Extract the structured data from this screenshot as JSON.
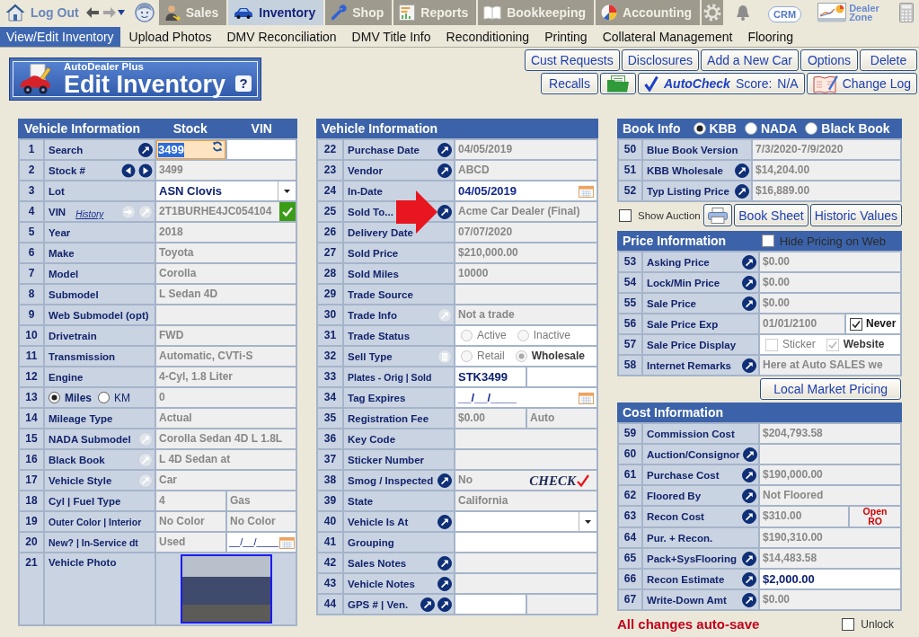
{
  "top_nav": {
    "logout": "Log Out",
    "tabs": [
      {
        "label": "Sales",
        "selected": false
      },
      {
        "label": "Inventory",
        "selected": true
      },
      {
        "label": "Shop",
        "selected": false
      },
      {
        "label": "Reports",
        "selected": false
      },
      {
        "label": "Bookkeeping",
        "selected": false
      },
      {
        "label": "Accounting",
        "selected": false
      }
    ],
    "crm": "CRM",
    "dealer_zone": "Dealer Zone"
  },
  "sub_nav": [
    {
      "label": "View/Edit Inventory",
      "selected": true
    },
    {
      "label": "Upload Photos",
      "selected": false
    },
    {
      "label": "DMV Reconciliation",
      "selected": false
    },
    {
      "label": "DMV Title Info",
      "selected": false
    },
    {
      "label": "Reconditioning",
      "selected": false
    },
    {
      "label": "Printing",
      "selected": false
    },
    {
      "label": "Collateral Management",
      "selected": false
    },
    {
      "label": "Flooring",
      "selected": false
    }
  ],
  "header": {
    "brand": "AutoDealer Plus",
    "title": "Edit Inventory",
    "help": "?"
  },
  "action_buttons": [
    [
      {
        "kind": "text",
        "label": "Cust Requests"
      },
      {
        "kind": "text",
        "label": "Disclosures"
      },
      {
        "kind": "text",
        "label": "Add a New Car"
      },
      {
        "kind": "text",
        "label": "Options"
      },
      {
        "kind": "text",
        "label": "Delete"
      }
    ],
    [
      {
        "kind": "text",
        "label": "Recalls"
      },
      {
        "kind": "folder"
      },
      {
        "kind": "autocheck",
        "label": "AutoCheck",
        "score_label": "Score:",
        "score": "N/A"
      },
      {
        "kind": "changelog",
        "label": "Change Log"
      }
    ]
  ],
  "vehicle_info": {
    "headers": [
      "Vehicle Information",
      "Stock",
      "VIN"
    ],
    "rows": [
      {
        "num": "1",
        "label": "Search",
        "actions": [
          {
            "kind": "jump",
            "disabled": false
          }
        ],
        "cells": [
          {
            "kind": "search",
            "value": "3499"
          },
          {
            "kind": "input"
          }
        ]
      },
      {
        "num": "2",
        "label": "Stock #",
        "actions": [
          {
            "kind": "prev",
            "disabled": false
          },
          {
            "kind": "next",
            "disabled": false
          }
        ],
        "cells": [
          {
            "kind": "readonly",
            "value": "3499"
          }
        ]
      },
      {
        "num": "3",
        "label": "Lot",
        "cells": [
          {
            "kind": "select",
            "value": "ASN Clovis"
          }
        ]
      },
      {
        "num": "4",
        "label": "VIN",
        "link": "History",
        "actions": [
          {
            "kind": "decode",
            "disabled": true
          },
          {
            "kind": "jump",
            "disabled": true
          }
        ],
        "cells": [
          {
            "kind": "readonly",
            "value": "2T1BURHE4JC054104",
            "verified": true
          }
        ]
      },
      {
        "num": "5",
        "label": "Year",
        "cells": [
          {
            "kind": "readonly",
            "value": "2018"
          }
        ]
      },
      {
        "num": "6",
        "label": "Make",
        "cells": [
          {
            "kind": "readonly",
            "value": "Toyota"
          }
        ]
      },
      {
        "num": "7",
        "label": "Model",
        "cells": [
          {
            "kind": "readonly",
            "value": "Corolla"
          }
        ]
      },
      {
        "num": "8",
        "label": "Submodel",
        "cells": [
          {
            "kind": "readonly",
            "value": "L Sedan 4D"
          }
        ]
      },
      {
        "num": "9",
        "label": "Web Submodel (opt)",
        "cells": [
          {
            "kind": "readonly"
          }
        ]
      },
      {
        "num": "10",
        "label": "Drivetrain",
        "cells": [
          {
            "kind": "readonly",
            "value": "FWD"
          }
        ]
      },
      {
        "num": "11",
        "label": "Transmission",
        "cells": [
          {
            "kind": "readonly",
            "value": "Automatic, CVTi-S"
          }
        ]
      },
      {
        "num": "12",
        "label": "Engine",
        "cells": [
          {
            "kind": "readonly",
            "value": "4-Cyl, 1.8 Liter"
          }
        ]
      },
      {
        "num": "13",
        "options": [
          {
            "label": "Miles",
            "selected": true
          },
          {
            "label": "KM",
            "selected": false
          }
        ],
        "cells": [
          {
            "kind": "readonly",
            "value": "0"
          }
        ]
      },
      {
        "num": "14",
        "label": "Mileage Type",
        "cells": [
          {
            "kind": "readonly",
            "value": "Actual"
          }
        ]
      },
      {
        "num": "15",
        "label": "NADA Submodel",
        "actions": [
          {
            "kind": "jump",
            "disabled": true
          }
        ],
        "cells": [
          {
            "kind": "readonly",
            "value": "Corolla Sedan 4D L 1.8L"
          }
        ]
      },
      {
        "num": "16",
        "label": "Black Book",
        "actions": [
          {
            "kind": "jump",
            "disabled": true
          }
        ],
        "cells": [
          {
            "kind": "readonly",
            "value": "L 4D Sedan at"
          }
        ]
      },
      {
        "num": "17",
        "label": "Vehicle Style",
        "actions": [
          {
            "kind": "jump",
            "disabled": true
          }
        ],
        "cells": [
          {
            "kind": "readonly",
            "value": "Car"
          }
        ]
      },
      {
        "num": "18",
        "label": "Cyl | Fuel Type",
        "cells": [
          {
            "kind": "readonly",
            "value": "4"
          },
          {
            "kind": "readonly",
            "value": "Gas"
          }
        ]
      },
      {
        "num": "19",
        "label": "Outer Color | Interior",
        "cells": [
          {
            "kind": "readonly",
            "value": "No Color"
          },
          {
            "kind": "readonly",
            "value": "No Color"
          }
        ]
      },
      {
        "num": "20",
        "label": "New? | In-Service dt",
        "cells": [
          {
            "kind": "readonly",
            "value": "Used"
          },
          {
            "kind": "date",
            "value": "__/__/____"
          }
        ]
      },
      {
        "num": "21",
        "label": "Vehicle Photo",
        "cells": [
          {
            "kind": "photo"
          }
        ]
      }
    ]
  },
  "vehicle_info_2": {
    "title": "Vehicle Information",
    "rows": [
      {
        "num": "22",
        "label": "Purchase Date",
        "actions": [
          {
            "kind": "jump",
            "disabled": false
          }
        ],
        "cells": [
          {
            "kind": "readonly",
            "value": "04/05/2019"
          }
        ]
      },
      {
        "num": "23",
        "label": "Vendor",
        "actions": [
          {
            "kind": "jump",
            "disabled": false
          }
        ],
        "cells": [
          {
            "kind": "readonly",
            "value": "ABCD"
          }
        ]
      },
      {
        "num": "24",
        "label": "In-Date",
        "cells": [
          {
            "kind": "date",
            "value": "04/05/2019"
          }
        ]
      },
      {
        "num": "25",
        "label": "Sold To...",
        "actions": [
          {
            "kind": "jump",
            "disabled": false
          }
        ],
        "pointer": true,
        "cells": [
          {
            "kind": "readonly",
            "value": "Acme Car Dealer (Final)"
          }
        ]
      },
      {
        "num": "26",
        "label": "Delivery Date",
        "cells": [
          {
            "kind": "readonly",
            "value": "07/07/2020"
          }
        ]
      },
      {
        "num": "27",
        "label": "Sold Price",
        "cells": [
          {
            "kind": "readonly",
            "value": "$210,000.00"
          }
        ]
      },
      {
        "num": "28",
        "label": "Sold Miles",
        "cells": [
          {
            "kind": "readonly",
            "value": "10000"
          }
        ]
      },
      {
        "num": "29",
        "label": "Trade Source",
        "cells": [
          {
            "kind": "readonly"
          }
        ]
      },
      {
        "num": "30",
        "label": "Trade Info",
        "actions": [
          {
            "kind": "jump",
            "disabled": true
          }
        ],
        "cells": [
          {
            "kind": "readonly",
            "value": "Not a trade"
          }
        ]
      },
      {
        "num": "31",
        "label": "Trade Status",
        "cells": [
          {
            "kind": "radios",
            "disabled": true,
            "options": [
              {
                "label": "Active",
                "selected": false
              },
              {
                "label": "Inactive",
                "selected": false
              }
            ]
          }
        ]
      },
      {
        "num": "32",
        "label": "Sell Type",
        "actions": [
          {
            "kind": "trash",
            "disabled": true
          }
        ],
        "cells": [
          {
            "kind": "radios",
            "disabled": true,
            "options": [
              {
                "label": "Retail",
                "selected": false
              },
              {
                "label": "Wholesale",
                "selected": true
              }
            ]
          }
        ]
      },
      {
        "num": "33",
        "label": "Plates - Orig | Sold",
        "cells": [
          {
            "kind": "input",
            "value": "STK3499"
          },
          {
            "kind": "input"
          }
        ]
      },
      {
        "num": "34",
        "label": "Tag Expires",
        "cells": [
          {
            "kind": "date",
            "value": "__/__/____"
          }
        ]
      },
      {
        "num": "35",
        "label": "Registration Fee",
        "cells": [
          {
            "kind": "readonly",
            "value": "$0.00"
          },
          {
            "kind": "readonly",
            "value": "Auto"
          }
        ]
      },
      {
        "num": "36",
        "label": "Key Code",
        "cells": [
          {
            "kind": "readonly"
          }
        ]
      },
      {
        "num": "37",
        "label": "Sticker Number",
        "cells": [
          {
            "kind": "readonly"
          }
        ]
      },
      {
        "num": "38",
        "label": "Smog / Inspected",
        "actions": [
          {
            "kind": "jump",
            "disabled": false
          }
        ],
        "cells": [
          {
            "kind": "readonly",
            "value": "No",
            "logo": "CHECK"
          }
        ]
      },
      {
        "num": "39",
        "label": "State",
        "cells": [
          {
            "kind": "readonly",
            "value": "California"
          }
        ]
      },
      {
        "num": "40",
        "label": "Vehicle Is At",
        "actions": [
          {
            "kind": "jump",
            "disabled": false
          }
        ],
        "cells": [
          {
            "kind": "select"
          }
        ]
      },
      {
        "num": "41",
        "label": "Grouping",
        "cells": [
          {
            "kind": "input"
          }
        ]
      },
      {
        "num": "42",
        "label": "Sales Notes",
        "actions": [
          {
            "kind": "jump",
            "disabled": false
          }
        ],
        "cells": [
          {
            "kind": "readonly"
          }
        ]
      },
      {
        "num": "43",
        "label": "Vehicle Notes",
        "actions": [
          {
            "kind": "jump",
            "disabled": false
          }
        ],
        "cells": [
          {
            "kind": "readonly"
          }
        ]
      },
      {
        "num": "44",
        "label": "GPS # | Ven.",
        "actions": [
          {
            "kind": "jump",
            "disabled": false
          },
          {
            "kind": "jump",
            "disabled": false
          }
        ],
        "cells": [
          {
            "kind": "input"
          },
          {
            "kind": "readonly"
          }
        ]
      }
    ]
  },
  "book_info": {
    "title": "Book Info",
    "sources": [
      {
        "label": "KBB",
        "selected": true
      },
      {
        "label": "NADA",
        "selected": false
      },
      {
        "label": "Black Book",
        "selected": false
      }
    ],
    "rows": [
      {
        "num": "50",
        "label": "Blue Book Version",
        "cells": [
          {
            "kind": "readonly",
            "value": "7/3/2020-7/9/2020"
          }
        ]
      },
      {
        "num": "51",
        "label": "KBB Wholesale",
        "actions": [
          {
            "kind": "jump",
            "disabled": false
          }
        ],
        "cells": [
          {
            "kind": "readonly",
            "value": "$14,204.00"
          }
        ]
      },
      {
        "num": "52",
        "label": "Typ Listing Price",
        "actions": [
          {
            "kind": "jump",
            "disabled": false
          }
        ],
        "cells": [
          {
            "kind": "readonly",
            "value": "$16,889.00"
          }
        ]
      }
    ],
    "show_auction": {
      "label": "Show Auction",
      "checked": false
    },
    "tools": [
      {
        "kind": "print"
      },
      {
        "kind": "text",
        "label": "Book Sheet"
      },
      {
        "kind": "text",
        "label": "Historic Values"
      }
    ]
  },
  "price_info": {
    "title": "Price Information",
    "hide_pricing": {
      "label": "Hide Pricing on Web",
      "checked": false
    },
    "rows": [
      {
        "num": "53",
        "label": "Asking Price",
        "actions": [
          {
            "kind": "jump",
            "disabled": false
          }
        ],
        "cells": [
          {
            "kind": "readonly",
            "value": "$0.00"
          }
        ]
      },
      {
        "num": "54",
        "label": "Lock/Min Price",
        "actions": [
          {
            "kind": "jump",
            "disabled": false
          }
        ],
        "cells": [
          {
            "kind": "readonly",
            "value": "$0.00"
          }
        ]
      },
      {
        "num": "55",
        "label": "Sale Price",
        "actions": [
          {
            "kind": "jump",
            "disabled": false
          }
        ],
        "cells": [
          {
            "kind": "readonly",
            "value": "$0.00"
          }
        ]
      },
      {
        "num": "56",
        "label": "Sale Price Exp",
        "cells": [
          {
            "kind": "readonly",
            "value": "01/01/2100"
          },
          {
            "kind": "checks",
            "disabled": false,
            "options": [
              {
                "label": "Never",
                "checked": true
              }
            ]
          }
        ]
      },
      {
        "num": "57",
        "label": "Sale Price Display",
        "cells": [
          {
            "kind": "checks",
            "disabled": true,
            "options": [
              {
                "label": "Sticker",
                "checked": false
              },
              {
                "label": "Website",
                "checked": true
              }
            ]
          }
        ]
      },
      {
        "num": "58",
        "label": "Internet Remarks",
        "actions": [
          {
            "kind": "jump",
            "disabled": false
          }
        ],
        "cells": [
          {
            "kind": "readonly",
            "value": "Here at Auto SALES we"
          }
        ]
      }
    ],
    "button": "Local Market Pricing"
  },
  "cost_info": {
    "title": "Cost Information",
    "rows": [
      {
        "num": "59",
        "label": "Commission Cost",
        "cells": [
          {
            "kind": "readonly",
            "value": "$204,793.58"
          }
        ]
      },
      {
        "num": "60",
        "label": "Auction/Consignor",
        "actions": [
          {
            "kind": "jump",
            "disabled": false
          }
        ],
        "cells": [
          {
            "kind": "readonly"
          }
        ]
      },
      {
        "num": "61",
        "label": "Purchase Cost",
        "actions": [
          {
            "kind": "jump",
            "disabled": false
          }
        ],
        "cells": [
          {
            "kind": "readonly",
            "value": "$190,000.00"
          }
        ]
      },
      {
        "num": "62",
        "label": "Floored By",
        "actions": [
          {
            "kind": "jump",
            "disabled": false
          }
        ],
        "cells": [
          {
            "kind": "readonly",
            "value": "Not Floored"
          }
        ]
      },
      {
        "num": "63",
        "label": "Recon Cost",
        "actions": [
          {
            "kind": "jump",
            "disabled": false
          }
        ],
        "cells": [
          {
            "kind": "readonly",
            "value": "$310.00"
          },
          {
            "kind": "link",
            "value": "Open RO"
          }
        ]
      },
      {
        "num": "64",
        "label": "Pur. + Recon.",
        "cells": [
          {
            "kind": "readonly",
            "value": "$190,310.00"
          }
        ]
      },
      {
        "num": "65",
        "label": "Pack+SysFlooring",
        "actions": [
          {
            "kind": "jump",
            "disabled": false
          }
        ],
        "cells": [
          {
            "kind": "readonly",
            "value": "$14,483.58"
          }
        ]
      },
      {
        "num": "66",
        "label": "Recon Estimate",
        "actions": [
          {
            "kind": "jump",
            "disabled": false
          }
        ],
        "cells": [
          {
            "kind": "input",
            "value": "$2,000.00"
          }
        ]
      },
      {
        "num": "67",
        "label": "Write-Down Amt",
        "actions": [
          {
            "kind": "jump",
            "disabled": false
          }
        ],
        "cells": [
          {
            "kind": "readonly",
            "value": "$0.00"
          }
        ]
      }
    ]
  },
  "footer": {
    "note": "All changes auto-save",
    "unlock": {
      "label": "Unlock",
      "checked": false
    }
  }
}
